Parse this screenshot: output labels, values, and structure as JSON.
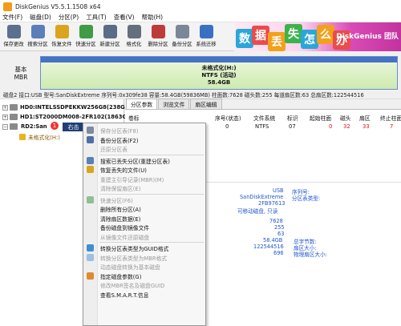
{
  "window": {
    "title": "DiskGenius V5.5.1.1508 x64"
  },
  "menu": [
    "文件(F)",
    "磁盘(D)",
    "分区(P)",
    "工具(T)",
    "查看(V)",
    "帮助(H)"
  ],
  "toolbar": [
    {
      "label": "保存更改",
      "icon": "save-icon",
      "color": "#5b6f8f"
    },
    {
      "label": "搜索分区",
      "icon": "search-icon",
      "color": "#5b7fb8"
    },
    {
      "label": "恢复文件",
      "icon": "recover-icon",
      "color": "#d9a51e"
    },
    {
      "label": "快速分区",
      "icon": "quick-partition-icon",
      "color": "#3f9b45"
    },
    {
      "label": "新建分区",
      "icon": "new-partition-icon",
      "color": "#5a6c86"
    },
    {
      "label": "格式化",
      "icon": "format-icon",
      "color": "#646e7c"
    },
    {
      "label": "删除分区",
      "icon": "delete-icon",
      "color": "#bf3a3a"
    },
    {
      "label": "备份分区",
      "icon": "backup-icon",
      "color": "#7b8799"
    },
    {
      "label": "系统迁移",
      "icon": "migrate-icon",
      "color": "#3b6fc4"
    }
  ],
  "banner": {
    "chars": [
      "数",
      "据",
      "丢",
      "失",
      "怎",
      "么",
      "办"
    ],
    "brand": "DiskGenius 团队"
  },
  "disk": {
    "label_top": "基本",
    "label_bottom": "MBR",
    "partition_line1": "未格式化(H:)",
    "partition_line2": "NTFS (活动)",
    "partition_line3": "58.4GB",
    "info": "磁盘2 接口:USB  型号:SanDiskExtreme  序列号:0x309fe38  容量:58.4GB(59836MB)  柱面数:7628  磁头数:255  每道扇区数:63  总扇区数:122544516"
  },
  "tree": {
    "hd0": "HD0:INTELSSDPEKKW256G8(238G",
    "hd1": "HD1:ST2000DM008-2FR102(1863G",
    "rd2": "RD2:San",
    "rd2_part": "未格式化(H:)",
    "badge": "1",
    "right_click_label": "右击"
  },
  "tabs": [
    "分区参数",
    "浏览文件",
    "扇区编辑"
  ],
  "partition_table": {
    "headers": [
      "卷标",
      "序号(状态)",
      "文件系统",
      "标识",
      "起始柱面",
      "磁头",
      "扇区",
      "终止柱面"
    ],
    "row": [
      "",
      "0",
      "NTFS",
      "07",
      "0",
      "32",
      "33",
      "7"
    ]
  },
  "details": {
    "values": [
      "USB",
      "SanDiskExtreme",
      "2FB97613",
      "可移动磁盘, 只读",
      "7628",
      "255",
      "63",
      "58.4GB",
      "122544516",
      "696"
    ],
    "labels": [
      "序列号:",
      "分区表类型:",
      "总字节数:",
      "扇区大小:",
      "物理扇区大小:"
    ]
  },
  "context_menu": [
    {
      "label": "保存分区表(F8)",
      "enabled": false,
      "icon": "save-icon",
      "color": "#7c8aa3"
    },
    {
      "label": "备份分区表(F2)",
      "enabled": true,
      "icon": "backup-icon",
      "color": "#4e6ea8"
    },
    {
      "label": "还原分区表",
      "enabled": false,
      "icon": "",
      "color": ""
    },
    {
      "sep": true
    },
    {
      "label": "搜索已丢失分区(重建分区表)",
      "enabled": true,
      "icon": "search-icon",
      "color": "#5b7fb8"
    },
    {
      "label": "恢复丢失的文件(U)",
      "enabled": true,
      "icon": "recover-icon",
      "color": "#d9a51e"
    },
    {
      "label": "重建主引导记录(MBR)(M)",
      "enabled": false,
      "icon": "",
      "color": ""
    },
    {
      "label": "清除保留扇区(E)",
      "enabled": false,
      "icon": "",
      "color": ""
    },
    {
      "sep": true
    },
    {
      "label": "快速分区(F6)",
      "enabled": false,
      "icon": "quick-partition-icon",
      "color": "#8fbf93"
    },
    {
      "label": "删除所有分区(A)",
      "enabled": true,
      "icon": "",
      "color": ""
    },
    {
      "label": "清除扇区数据(E)",
      "enabled": true,
      "icon": "",
      "color": ""
    },
    {
      "label": "备份磁盘到镜像文件",
      "enabled": true,
      "icon": "",
      "color": ""
    },
    {
      "label": "从镜像文件还原磁盘",
      "enabled": false,
      "icon": "",
      "color": ""
    },
    {
      "sep": true
    },
    {
      "label": "转换分区表类型为GUID格式",
      "enabled": true,
      "icon": "convert-icon",
      "color": "#3f8fd0"
    },
    {
      "label": "转换分区表类型为MBR格式",
      "enabled": false,
      "icon": "convert-icon",
      "color": "#9cc0e0"
    },
    {
      "label": "动态磁盘转换为基本磁盘",
      "enabled": false,
      "icon": "",
      "color": ""
    },
    {
      "label": "指定磁盘参数(G)",
      "enabled": true,
      "icon": "disk-params-icon",
      "color": "#e08a2d"
    },
    {
      "label": "修改MBR签名及磁盘GUID",
      "enabled": false,
      "icon": "",
      "color": ""
    },
    {
      "label": "查看S.M.A.R.T.信息",
      "enabled": true,
      "icon": "",
      "color": ""
    }
  ]
}
